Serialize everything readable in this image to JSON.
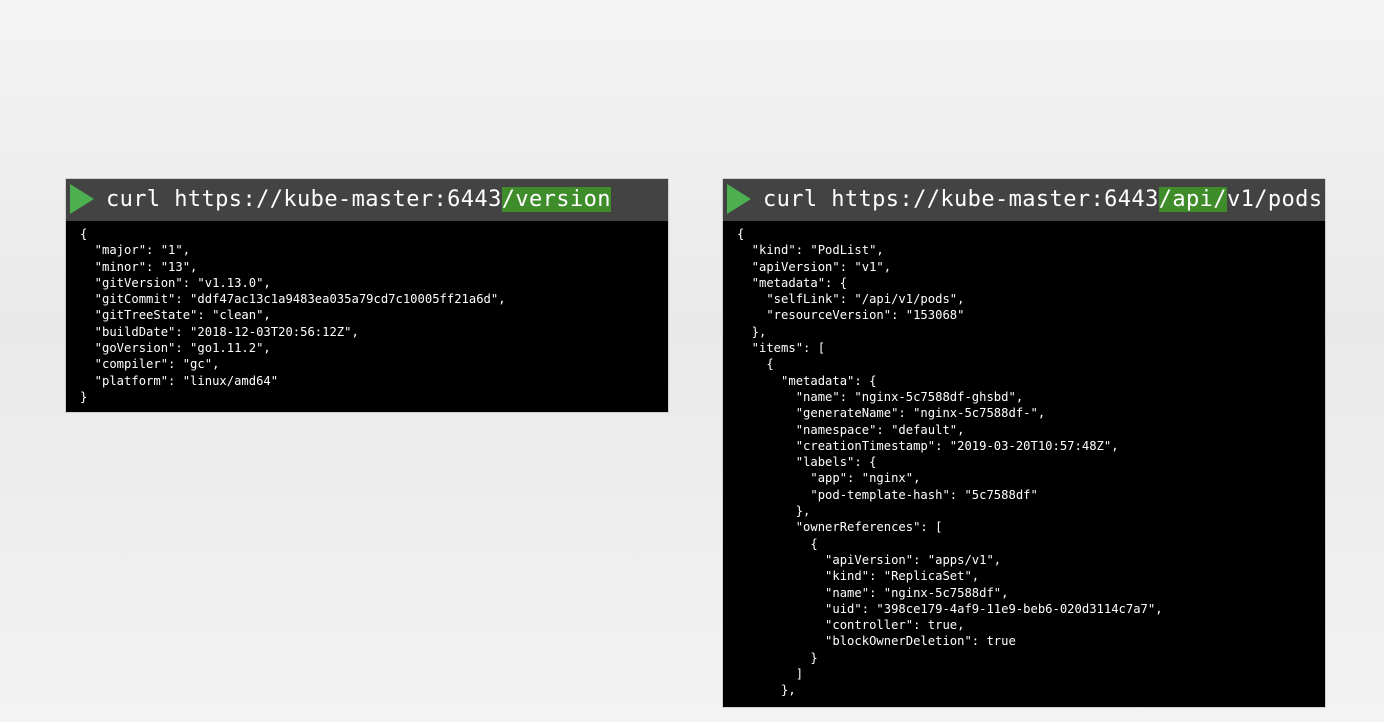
{
  "left_panel": {
    "command_prefix": "curl https://kube-master:6443",
    "command_highlight": "/version",
    "output": "{\n  \"major\": \"1\",\n  \"minor\": \"13\",\n  \"gitVersion\": \"v1.13.0\",\n  \"gitCommit\": \"ddf47ac13c1a9483ea035a79cd7c10005ff21a6d\",\n  \"gitTreeState\": \"clean\",\n  \"buildDate\": \"2018-12-03T20:56:12Z\",\n  \"goVersion\": \"go1.11.2\",\n  \"compiler\": \"gc\",\n  \"platform\": \"linux/amd64\"\n}",
    "icon": "play-icon",
    "icon_color": "#4caf50"
  },
  "right_panel": {
    "command_prefix": "curl https://kube-master:6443",
    "command_highlight": "/api/",
    "command_suffix": "v1/pods",
    "output": "{\n  \"kind\": \"PodList\",\n  \"apiVersion\": \"v1\",\n  \"metadata\": {\n    \"selfLink\": \"/api/v1/pods\",\n    \"resourceVersion\": \"153068\"\n  },\n  \"items\": [\n    {\n      \"metadata\": {\n        \"name\": \"nginx-5c7588df-ghsbd\",\n        \"generateName\": \"nginx-5c7588df-\",\n        \"namespace\": \"default\",\n        \"creationTimestamp\": \"2019-03-20T10:57:48Z\",\n        \"labels\": {\n          \"app\": \"nginx\",\n          \"pod-template-hash\": \"5c7588df\"\n        },\n        \"ownerReferences\": [\n          {\n            \"apiVersion\": \"apps/v1\",\n            \"kind\": \"ReplicaSet\",\n            \"name\": \"nginx-5c7588df\",\n            \"uid\": \"398ce179-4af9-11e9-beb6-020d3114c7a7\",\n            \"controller\": true,\n            \"blockOwnerDeletion\": true\n          }\n        ]\n      },",
    "icon": "play-icon",
    "icon_color": "#4caf50"
  },
  "colors": {
    "highlight": "#3f8d2a",
    "command_bar": "#434343",
    "terminal_bg": "#000000"
  }
}
